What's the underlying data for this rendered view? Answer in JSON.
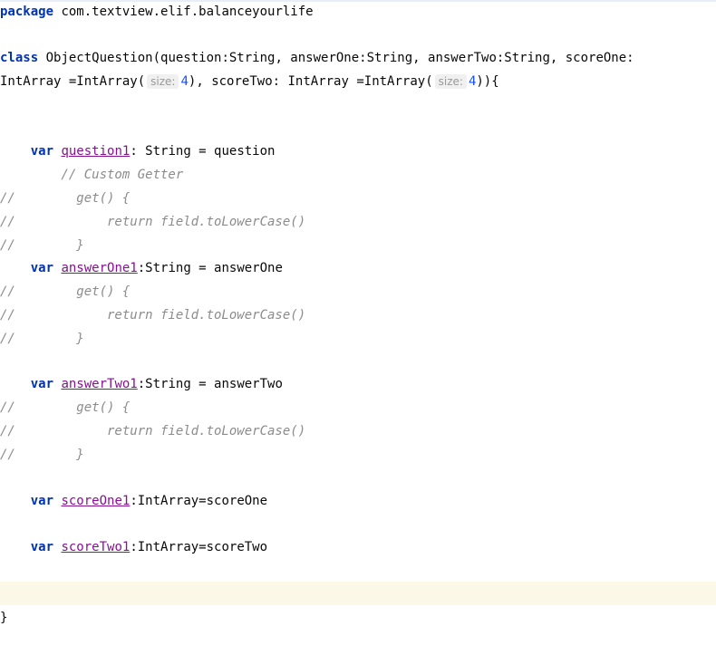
{
  "editor": {
    "lines": {
      "l1": {
        "kw": "package",
        "rest": " com.textview.elif.balanceyourlife"
      },
      "l2": {
        "kw": "class",
        "rest": " ObjectQuestion(question:String, answerOne:String, answerTwo:String, scoreOne:"
      },
      "l3": {
        "a": "IntArray =IntArray(",
        "hint": "size:",
        "num": "4",
        "b": "), scoreTwo: IntArray =IntArray(",
        "hint2": "size:",
        "num2": "4",
        "c": ")){"
      },
      "l4": {
        "indent": "    ",
        "kw": "var",
        "sp": " ",
        "prop": "question1",
        "rest": ": String = question"
      },
      "l5": {
        "text": "        // Custom Getter"
      },
      "l6": {
        "slash": "//",
        "text": "        get() {"
      },
      "l7": {
        "slash": "//",
        "text": "            return field.toLowerCase()"
      },
      "l8": {
        "slash": "//",
        "text": "        }"
      },
      "l9": {
        "indent": "    ",
        "kw": "var",
        "sp": " ",
        "prop": "answerOne1",
        "rest": ":String = answerOne"
      },
      "l10": {
        "slash": "//",
        "text": "        get() {"
      },
      "l11": {
        "slash": "//",
        "text": "            return field.toLowerCase()"
      },
      "l12": {
        "slash": "//",
        "text": "        }"
      },
      "l13": {
        "indent": "    ",
        "kw": "var",
        "sp": " ",
        "prop": "answerTwo1",
        "rest": ":String = answerTwo"
      },
      "l14": {
        "slash": "//",
        "text": "        get() {"
      },
      "l15": {
        "slash": "//",
        "text": "            return field.toLowerCase()"
      },
      "l16": {
        "slash": "//",
        "text": "        }"
      },
      "l17": {
        "indent": "    ",
        "kw": "var",
        "sp": " ",
        "prop": "scoreOne1",
        "rest": ":IntArray=scoreOne"
      },
      "l18": {
        "indent": "    ",
        "kw": "var",
        "sp": " ",
        "prop": "scoreTwo1",
        "rest": ":IntArray=scoreTwo"
      },
      "l19": {
        "text": "}"
      }
    },
    "colors": {
      "keyword": "#0033b3",
      "comment": "#8c8c8c",
      "property": "#871094",
      "number": "#1750eb",
      "current_line": "#fcf8e8"
    }
  }
}
